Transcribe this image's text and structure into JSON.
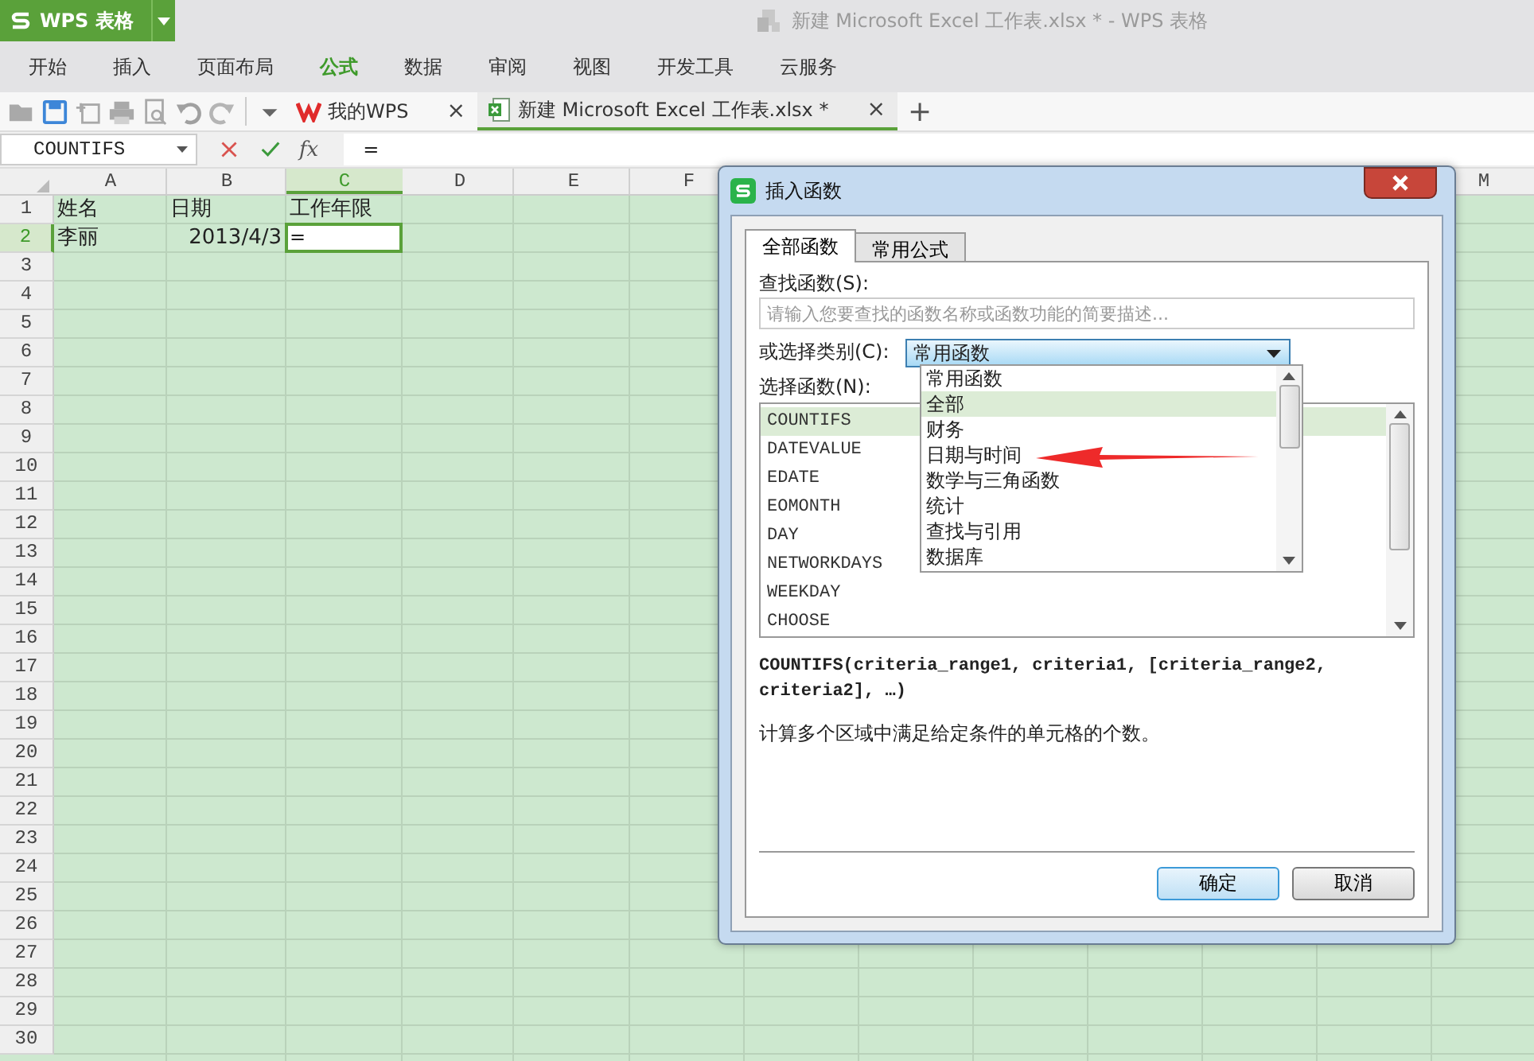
{
  "app_button": {
    "label": "WPS 表格"
  },
  "window": {
    "title": "新建 Microsoft Excel 工作表.xlsx * - WPS 表格"
  },
  "menu": [
    {
      "label": "开始",
      "selected": false
    },
    {
      "label": "插入",
      "selected": false
    },
    {
      "label": "页面布局",
      "selected": false
    },
    {
      "label": "公式",
      "selected": true
    },
    {
      "label": "数据",
      "selected": false
    },
    {
      "label": "审阅",
      "selected": false
    },
    {
      "label": "视图",
      "selected": false
    },
    {
      "label": "开发工具",
      "selected": false
    },
    {
      "label": "云服务",
      "selected": false
    }
  ],
  "doc_tabs": [
    {
      "label": "我的WPS",
      "kind": "home",
      "selected": false,
      "close": "×"
    },
    {
      "label": "新建 Microsoft Excel 工作表.xlsx *",
      "kind": "sheet",
      "selected": true,
      "close": "×"
    }
  ],
  "new_tab": "+",
  "formula_bar": {
    "name_box": "COUNTIFS",
    "fx": "fx",
    "value": "="
  },
  "sheet": {
    "columns": [
      {
        "label": "A",
        "selected": false
      },
      {
        "label": "B",
        "selected": false
      },
      {
        "label": "C",
        "selected": true
      },
      {
        "label": "D",
        "selected": false
      },
      {
        "label": "E",
        "selected": false
      },
      {
        "label": "F",
        "selected": false
      }
    ],
    "columns_right": [
      {
        "label": "M",
        "selected": false
      }
    ],
    "rows": [
      {
        "number": "1",
        "selected": false,
        "cells": [
          {
            "text": "姓名",
            "kind": "text",
            "active": false
          },
          {
            "text": "日期",
            "kind": "text",
            "active": false
          },
          {
            "text": "工作年限",
            "kind": "text",
            "active": false
          }
        ]
      },
      {
        "number": "2",
        "selected": true,
        "cells": [
          {
            "text": "李丽",
            "kind": "text",
            "active": false
          },
          {
            "text": "2013/4/3",
            "kind": "number",
            "active": false
          },
          {
            "text": "=",
            "kind": "text",
            "active": true
          }
        ]
      },
      {
        "number": "3",
        "selected": false
      },
      {
        "number": "4",
        "selected": false
      },
      {
        "number": "5",
        "selected": false
      },
      {
        "number": "6",
        "selected": false
      },
      {
        "number": "7",
        "selected": false
      },
      {
        "number": "8",
        "selected": false
      },
      {
        "number": "9",
        "selected": false
      },
      {
        "number": "10",
        "selected": false
      },
      {
        "number": "11",
        "selected": false
      },
      {
        "number": "12",
        "selected": false
      },
      {
        "number": "13",
        "selected": false
      },
      {
        "number": "14",
        "selected": false
      },
      {
        "number": "15",
        "selected": false
      },
      {
        "number": "16",
        "selected": false
      },
      {
        "number": "17",
        "selected": false
      },
      {
        "number": "18",
        "selected": false
      },
      {
        "number": "19",
        "selected": false
      },
      {
        "number": "20",
        "selected": false
      },
      {
        "number": "21",
        "selected": false
      },
      {
        "number": "22",
        "selected": false
      },
      {
        "number": "23",
        "selected": false
      },
      {
        "number": "24",
        "selected": false
      },
      {
        "number": "25",
        "selected": false
      },
      {
        "number": "26",
        "selected": false
      },
      {
        "number": "27",
        "selected": false
      },
      {
        "number": "28",
        "selected": false
      },
      {
        "number": "29",
        "selected": false
      },
      {
        "number": "30",
        "selected": false
      }
    ]
  },
  "dialog": {
    "title": "插入函数",
    "tabs": [
      {
        "label": "全部函数",
        "selected": true
      },
      {
        "label": "常用公式",
        "selected": false
      }
    ],
    "search_label": "查找函数(S):",
    "search_placeholder": "请输入您要查找的函数名称或函数功能的简要描述...",
    "category_label": "或选择类别(C):",
    "category_value": "常用函数",
    "category_options": [
      {
        "label": "常用函数",
        "selected": false
      },
      {
        "label": "全部",
        "selected": true
      },
      {
        "label": "财务",
        "selected": false
      },
      {
        "label": "日期与时间",
        "selected": false
      },
      {
        "label": "数学与三角函数",
        "selected": false
      },
      {
        "label": "统计",
        "selected": false
      },
      {
        "label": "查找与引用",
        "selected": false
      },
      {
        "label": "数据库",
        "selected": false
      }
    ],
    "function_label": "选择函数(N):",
    "functions": [
      {
        "label": "COUNTIFS",
        "selected": true
      },
      {
        "label": "DATEVALUE",
        "selected": false
      },
      {
        "label": "EDATE",
        "selected": false
      },
      {
        "label": "EOMONTH",
        "selected": false
      },
      {
        "label": "DAY",
        "selected": false
      },
      {
        "label": "NETWORKDAYS",
        "selected": false
      },
      {
        "label": "WEEKDAY",
        "selected": false
      },
      {
        "label": "CHOOSE",
        "selected": false
      }
    ],
    "syntax": "COUNTIFS(criteria_range1, criteria1, [criteria_range2, criteria2], …)",
    "description": "计算多个区域中满足给定条件的单元格的个数。",
    "buttons": [
      {
        "label": "确定",
        "kind": "primary"
      },
      {
        "label": "取消",
        "kind": "normal"
      }
    ]
  }
}
